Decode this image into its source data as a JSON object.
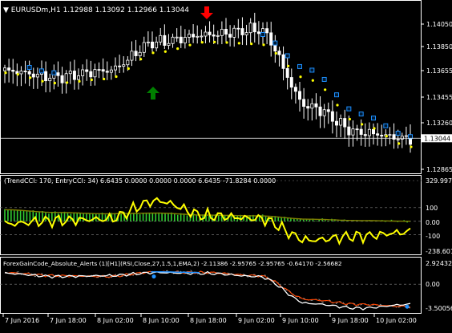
{
  "main": {
    "symbol": "EURUSDm,H1",
    "ohlc": "1.12988 1.13092 1.12966 1.13044",
    "price_ticks": [
      "1.14050",
      "1.13850",
      "1.13655",
      "1.13455",
      "1.13260",
      "1.12865"
    ],
    "current_price": "1.13044",
    "colors": {
      "bull_candle": "#000000",
      "bear_candle": "#ffffff",
      "candle_outline": "#ffffff",
      "trail_dots": "#ffff00",
      "trail_boxes": "#1e90ff",
      "buy_arrow": "#008000",
      "sell_arrow": "#ff0000",
      "price_line": "#ffffff"
    },
    "arrows": [
      {
        "type": "buy",
        "icon": "up-arrow-icon"
      },
      {
        "type": "sell",
        "icon": "down-arrow-icon"
      }
    ]
  },
  "cci": {
    "title": "(TrendCCI: 170, EntryCCI: 34)  6.6435 0.0000 0.0000 0.0000 6.6435 -71.8284 0.0000",
    "ticks": [
      "329.9975",
      "100",
      "0.00",
      "-100",
      "-238.6018"
    ],
    "colors": {
      "histogram": "#32cd32",
      "entry_line": "#ffff00",
      "trend_line": "#808000"
    }
  },
  "rsi": {
    "title": "ForexGainCode_Absolute_Alerts (1)[H1](RSI,Close,27,1.5,1,EMA,2) -2.11386 -2.95765 -2.95765 -0.64170 -2.56682",
    "ticks": [
      "2.92432",
      "0.00",
      "-3.50056"
    ],
    "colors": {
      "main_line": "#ffffff",
      "signal_up": "#1e90ff",
      "signal_down": "#ff4500",
      "dashed": "#aaaaaa"
    }
  },
  "time_axis": {
    "labels": [
      "7 Jun 2016",
      "7 Jun 18:00",
      "8 Jun 02:00",
      "8 Jun 10:00",
      "8 Jun 18:00",
      "9 Jun 02:00",
      "9 Jun 10:00",
      "9 Jun 18:00",
      "10 Jun 02:00"
    ]
  },
  "chart_data": [
    {
      "type": "candlestick",
      "title": "EURUSDm,H1",
      "ylim": [
        1.1275,
        1.142
      ],
      "x": [
        "7 Jun 2016",
        "7 Jun 18:00",
        "8 Jun 02:00",
        "8 Jun 10:00",
        "8 Jun 18:00",
        "9 Jun 02:00",
        "9 Jun 10:00",
        "9 Jun 18:00",
        "10 Jun 02:00"
      ],
      "close": [
        1.137,
        1.1364,
        1.137,
        1.1398,
        1.1405,
        1.141,
        1.1335,
        1.131,
        1.1304
      ],
      "trail_stop": [
        1.1372,
        1.1362,
        1.1366,
        1.1392,
        1.1402,
        1.14,
        1.1365,
        1.1322,
        1.13
      ]
    },
    {
      "type": "line",
      "title": "(TrendCCI: 170, EntryCCI: 34)",
      "ylim": [
        -238.6018,
        329.9975
      ],
      "x": [
        "7 Jun 2016",
        "7 Jun 18:00",
        "8 Jun 02:00",
        "8 Jun 10:00",
        "8 Jun 18:00",
        "9 Jun 02:00",
        "9 Jun 10:00",
        "9 Jun 18:00",
        "10 Jun 02:00"
      ],
      "series": [
        {
          "name": "EntryCCI",
          "values": [
            -20,
            5,
            15,
            150,
            40,
            20,
            -140,
            -110,
            -80
          ]
        },
        {
          "name": "TrendCCI",
          "values": [
            85,
            65,
            55,
            60,
            45,
            40,
            15,
            5,
            0
          ]
        }
      ]
    },
    {
      "type": "line",
      "title": "ForexGainCode_Absolute_Alerts (1)",
      "ylim": [
        -3.50056,
        2.92432
      ],
      "x": [
        "7 Jun 2016",
        "7 Jun 18:00",
        "8 Jun 02:00",
        "8 Jun 10:00",
        "8 Jun 18:00",
        "9 Jun 02:00",
        "9 Jun 10:00",
        "9 Jun 18:00",
        "10 Jun 02:00"
      ],
      "series": [
        {
          "name": "RSI",
          "values": [
            1.4,
            1.0,
            1.1,
            1.5,
            1.4,
            1.0,
            -2.5,
            -3.1,
            -2.6
          ]
        },
        {
          "name": "Signal",
          "values": [
            1.5,
            1.1,
            1.0,
            1.6,
            1.5,
            1.1,
            -2.0,
            -2.6,
            -2.9
          ]
        }
      ]
    }
  ]
}
